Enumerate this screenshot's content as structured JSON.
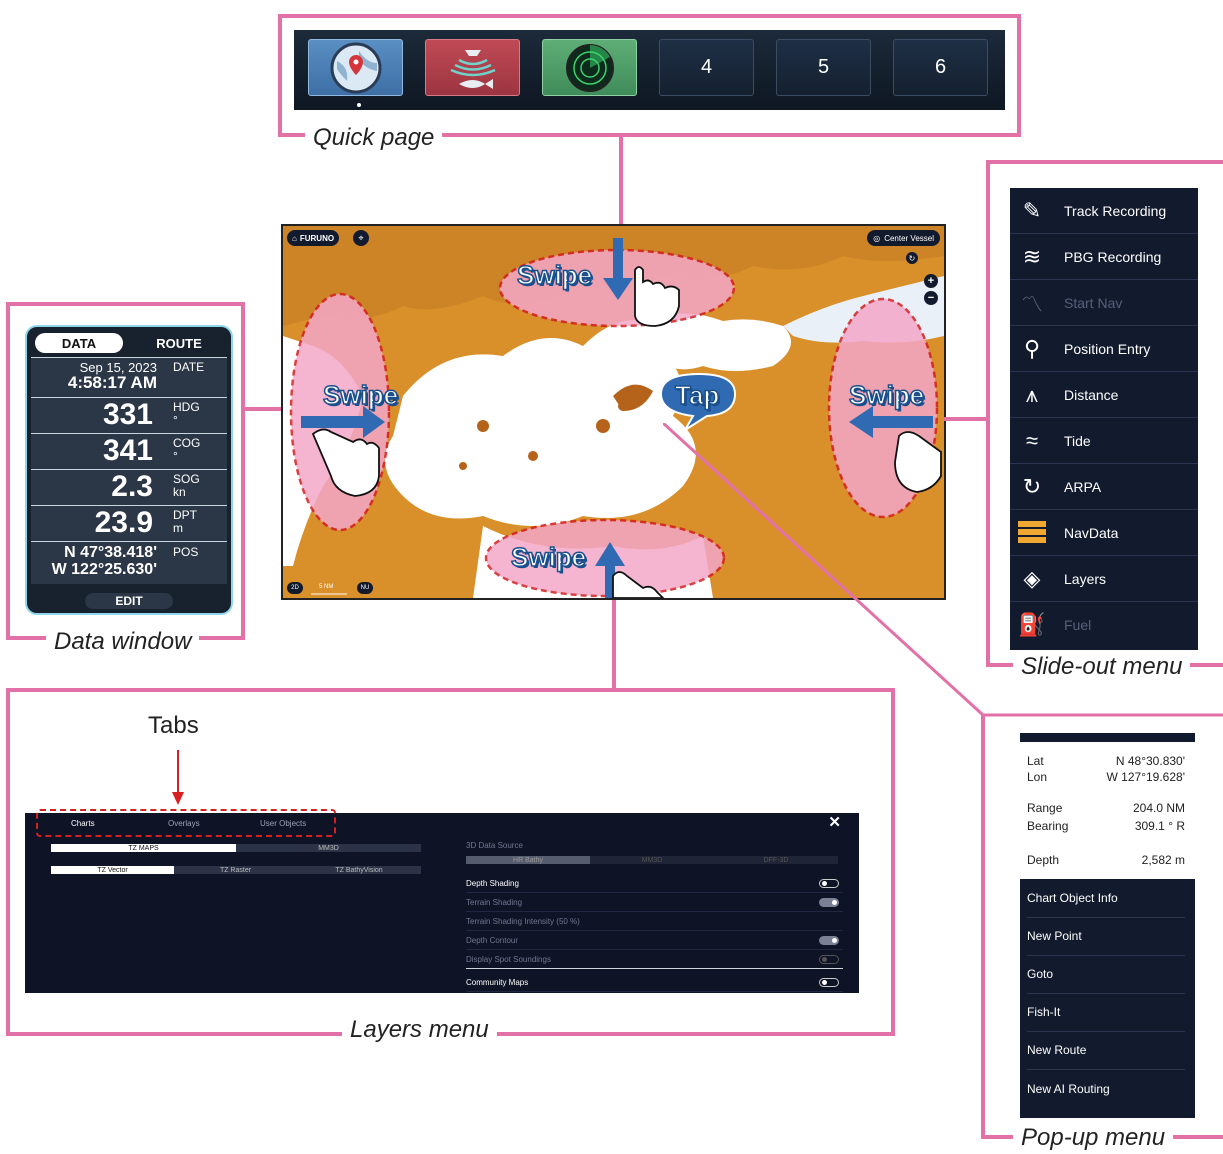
{
  "captions": {
    "quick_page": "Quick page",
    "data_window": "Data window",
    "slide_out": "Slide-out menu",
    "layers": "Layers menu",
    "popup": "Pop-up menu",
    "tabs": "Tabs"
  },
  "quick_page": {
    "tiles": [
      "",
      "",
      "",
      "4",
      "5",
      "6"
    ]
  },
  "data_window": {
    "tab_data": "DATA",
    "tab_route": "ROUTE",
    "date": "Sep 15, 2023",
    "time": "4:58:17 AM",
    "date_label": "DATE",
    "hdg_value": "331",
    "hdg_label": "HDG",
    "hdg_unit": "°",
    "cog_value": "341",
    "cog_label": "COG",
    "cog_unit": "°",
    "sog_value": "2.3",
    "sog_label": "SOG",
    "sog_unit": "kn",
    "dpt_value": "23.9",
    "dpt_label": "DPT",
    "dpt_unit": "m",
    "lat": "N 47°38.418'",
    "lon": "W 122°25.630'",
    "pos_label": "POS",
    "edit": "EDIT"
  },
  "chart": {
    "brand": "FURUNO",
    "center_vessel": "Center Vessel",
    "swipe": "Swipe",
    "tap": "Tap",
    "mode_2d": "2D",
    "scale": "5 NM",
    "orientation": "NU"
  },
  "slide_out": {
    "items": [
      {
        "label": "Track Recording",
        "icon": "pen-icon",
        "enabled": true
      },
      {
        "label": "PBG Recording",
        "icon": "boat-sonar-icon",
        "enabled": true
      },
      {
        "label": "Start Nav",
        "icon": "route-icon",
        "enabled": false
      },
      {
        "label": "Position Entry",
        "icon": "pin-icon",
        "enabled": true
      },
      {
        "label": "Distance",
        "icon": "compass-icon",
        "enabled": true
      },
      {
        "label": "Tide",
        "icon": "waves-icon",
        "enabled": true
      },
      {
        "label": "ARPA",
        "icon": "arpa-icon",
        "enabled": true
      },
      {
        "label": "NavData",
        "icon": "navdata-icon",
        "enabled": true
      },
      {
        "label": "Layers",
        "icon": "layers-icon",
        "enabled": true
      },
      {
        "label": "Fuel",
        "icon": "fuel-icon",
        "enabled": false
      }
    ]
  },
  "layers": {
    "tabs": [
      "Charts",
      "Overlays",
      "User Objects"
    ],
    "chart_source": [
      "TZ MAPS",
      "MM3D"
    ],
    "chart_type": [
      "TZ Vector",
      "TZ Raster",
      "TZ BathyVision"
    ],
    "source_3d_label": "3D Data Source",
    "source_3d": [
      "HR Bathy",
      "MM3D",
      "DFF-3D"
    ],
    "rows": [
      {
        "label": "Depth Shading",
        "enabled": true,
        "toggle": "off"
      },
      {
        "label": "Terrain Shading",
        "enabled": false,
        "toggle": "on"
      },
      {
        "label": "Terrain Shading Intensity (50 %)",
        "enabled": false,
        "toggle": "none"
      },
      {
        "label": "Depth Contour",
        "enabled": false,
        "toggle": "on"
      },
      {
        "label": "Display Spot Soundings",
        "enabled": false,
        "toggle": "off"
      },
      {
        "label": "Community Maps",
        "enabled": true,
        "toggle": "off"
      }
    ]
  },
  "popup": {
    "lat_label": "Lat",
    "lat": "N 48°30.830'",
    "lon_label": "Lon",
    "lon": "W 127°19.628'",
    "range_label": "Range",
    "range": "204.0 NM",
    "bearing_label": "Bearing",
    "bearing": "309.1 ° R",
    "depth_label": "Depth",
    "depth": "2,582 m",
    "items": [
      "Chart Object Info",
      "New Point",
      "Goto",
      "Fish-It",
      "New Route",
      "New AI Routing"
    ]
  }
}
